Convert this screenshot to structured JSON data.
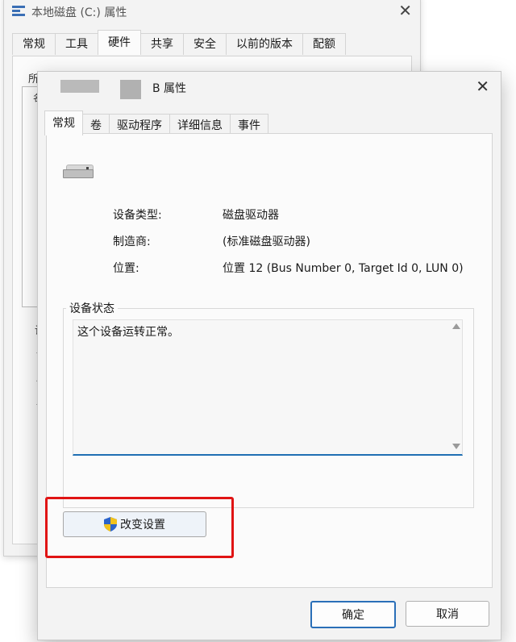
{
  "back_window": {
    "title": "本地磁盘 (C:) 属性",
    "close_glyph": "✕",
    "tabs": [
      "常规",
      "工具",
      "硬件",
      "共享",
      "安全",
      "以前的版本",
      "配额"
    ],
    "active_tab": "硬件",
    "fragments": [
      "所",
      "名",
      "设",
      "设",
      "位",
      "设"
    ]
  },
  "window": {
    "title": "B 属性",
    "close_glyph": "✕",
    "tabs": [
      "常规",
      "卷",
      "驱动程序",
      "详细信息",
      "事件"
    ],
    "active_tab": "常规"
  },
  "device_icon": "hard-drive-icon",
  "properties": [
    {
      "label": "设备类型:",
      "value": "磁盘驱动器"
    },
    {
      "label": "制造商:",
      "value": "(标准磁盘驱动器)"
    },
    {
      "label": "位置:",
      "value": "位置 12 (Bus Number 0, Target Id 0, LUN 0)"
    }
  ],
  "device_status": {
    "group_title": "设备状态",
    "text": "这个设备运转正常。"
  },
  "change_settings_button": {
    "label": "改变设置",
    "icon": "uac-shield-icon"
  },
  "footer": {
    "ok_label": "确定",
    "cancel_label": "取消"
  },
  "colors": {
    "highlight_border": "#e01414",
    "focus_accent": "#1f6fb3",
    "window_bg": "#f3f3f3",
    "panel_bg": "#fbfbfb"
  }
}
